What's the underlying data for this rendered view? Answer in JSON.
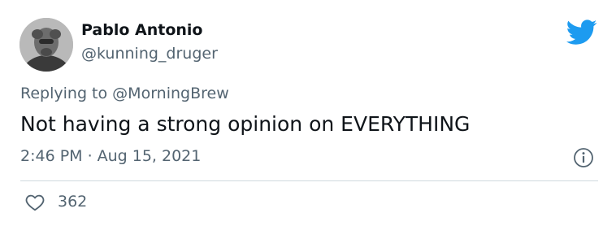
{
  "tweet": {
    "display_name": "Pablo Antonio",
    "handle": "@kunning_druger",
    "replying_prefix": "Replying to",
    "replying_to": "@MorningBrew",
    "text": "Not having a strong opinion on EVERYTHING",
    "time": "2:46 PM",
    "separator": "·",
    "date": "Aug 15, 2021",
    "likes": "362"
  },
  "icons": {
    "brand": "twitter-bird-icon",
    "info": "info-icon",
    "like": "heart-icon"
  },
  "colors": {
    "brand_blue": "#1d9bf0",
    "secondary_text": "#536471",
    "primary_text": "#0f1419",
    "divider": "#cfd9de"
  }
}
